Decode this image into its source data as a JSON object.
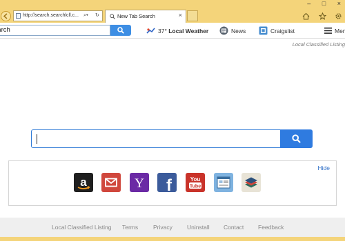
{
  "browser": {
    "address_url": "http://search.searchlcll.c...",
    "tab_title": "New Tab Search",
    "tab_close": "×",
    "window_controls": [
      "–",
      "□",
      "×"
    ],
    "icons": [
      "back-icon",
      "page-icon",
      "search-dropdown-icon",
      "refresh-icon",
      "home-icon",
      "star-icon",
      "gear-icon"
    ]
  },
  "toolbar": {
    "search_value": "earch",
    "weather_temp": "37°",
    "weather_label": "Local Weather",
    "news_label": "News",
    "craigslist_label": "Craigslist",
    "menu_label": "Menu"
  },
  "main": {
    "brand_top": "Local Classified Listing",
    "search_placeholder": "",
    "hide_label": "Hide",
    "shortcuts": [
      "Amazon",
      "Gmail",
      "Yahoo",
      "Facebook",
      "YouTube",
      "News",
      "Layers"
    ]
  },
  "footer": {
    "links": [
      "Local Classified Listing",
      "Terms",
      "Privacy",
      "Uninstall",
      "Contact",
      "Feedback"
    ]
  },
  "colors": {
    "chrome": "#f4d47a",
    "search_blue": "#2f7be0",
    "link_blue": "#2f6fc7"
  }
}
